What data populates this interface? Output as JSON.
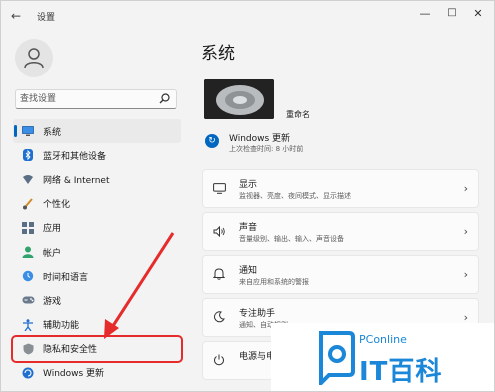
{
  "window": {
    "title": "设置",
    "back_icon": "arrow-left-icon",
    "controls": [
      "minimize-icon",
      "maximize-icon",
      "close-icon"
    ]
  },
  "sidebar": {
    "search_placeholder": "查找设置",
    "items": [
      {
        "label": "系统",
        "icon": "monitor-icon",
        "selected": true
      },
      {
        "label": "蓝牙和其他设备",
        "icon": "bluetooth-icon"
      },
      {
        "label": "网络 & Internet",
        "icon": "wifi-icon"
      },
      {
        "label": "个性化",
        "icon": "brush-icon"
      },
      {
        "label": "应用",
        "icon": "apps-icon"
      },
      {
        "label": "帐户",
        "icon": "person-icon"
      },
      {
        "label": "时间和语言",
        "icon": "globe-clock-icon"
      },
      {
        "label": "游戏",
        "icon": "gamepad-icon"
      },
      {
        "label": "辅助功能",
        "icon": "accessibility-icon"
      },
      {
        "label": "隐私和安全性",
        "icon": "shield-icon",
        "highlighted": true
      },
      {
        "label": "Windows 更新",
        "icon": "update-icon"
      }
    ]
  },
  "main": {
    "title": "系统",
    "device_rename": "重命名",
    "update": {
      "title": "Windows 更新",
      "subtitle": "上次检查时间: 8 小时前"
    },
    "cards": [
      {
        "title": "显示",
        "subtitle": "监视器、亮度、夜间模式、显示描述",
        "icon": "display-icon"
      },
      {
        "title": "声音",
        "subtitle": "音量级别、输出、输入、声音设备",
        "icon": "speaker-icon"
      },
      {
        "title": "通知",
        "subtitle": "来自应用和系统的警报",
        "icon": "bell-icon"
      },
      {
        "title": "专注助手",
        "subtitle": "通知、自动规则",
        "icon": "moon-icon"
      },
      {
        "title": "电源与电池",
        "subtitle": "",
        "icon": "power-icon"
      }
    ]
  },
  "watermark": {
    "brand_top": "PConline",
    "brand_main": "IT百科"
  },
  "colors": {
    "accent": "#0067c0",
    "highlight_box": "#e52b2b",
    "watermark": "#1a87d8"
  }
}
